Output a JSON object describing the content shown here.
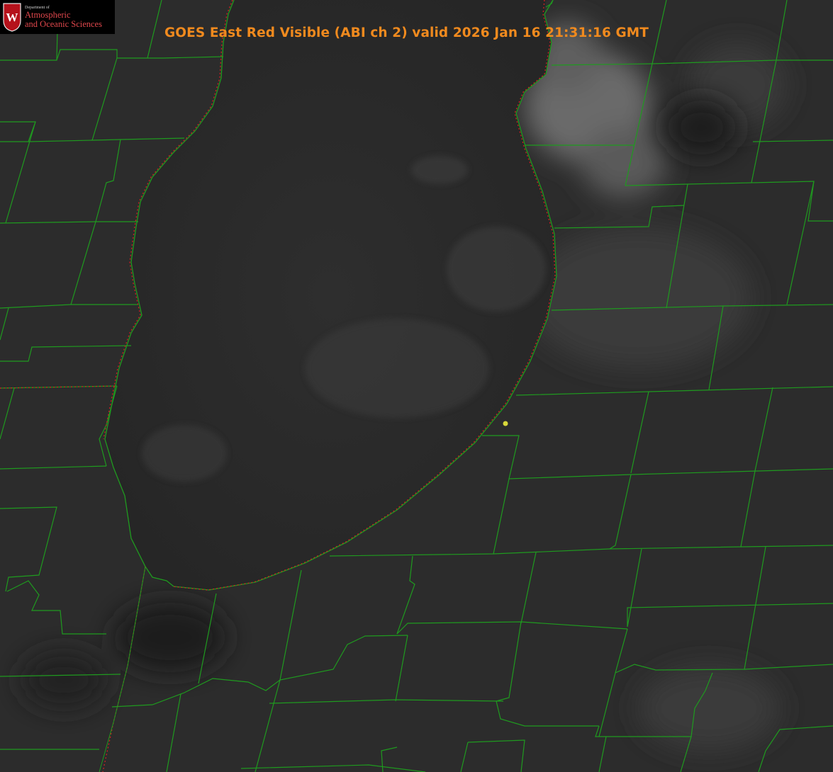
{
  "title": "GOES East Red Visible (ABI ch 2) valid 2026 Jan 16 21:31:16 GMT",
  "logo": {
    "department_line": "Department of",
    "name_line1": "Atmospheric",
    "name_line2": "and Oceanic Sciences",
    "seal_letter": "W"
  },
  "colors": {
    "title": "#f08a1e",
    "county_lines": "#1f9a1f",
    "state_line": "#cc2222",
    "station_marker": "#d8d83a",
    "logo_text": "#e0474c",
    "seal": "#b5121b"
  },
  "map_layers": [
    "satellite-visible-imagery",
    "county-boundaries",
    "state-boundaries",
    "lake-shoreline",
    "station-marker"
  ]
}
